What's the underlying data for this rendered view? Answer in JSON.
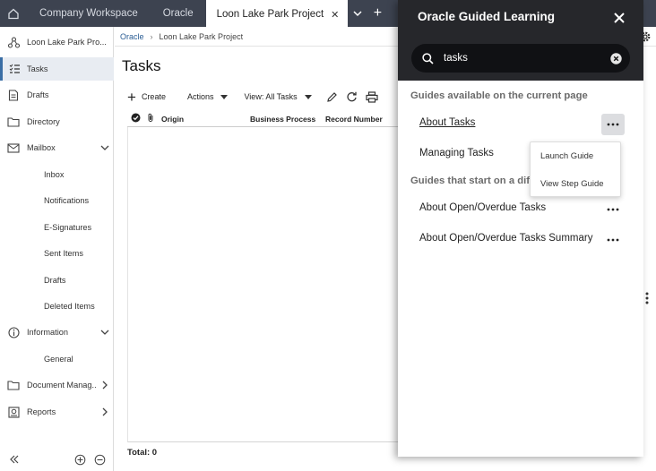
{
  "tabs": {
    "items": [
      {
        "label": "Company Workspace"
      },
      {
        "label": "Oracle"
      },
      {
        "label": "Loon Lake Park Project",
        "active": true
      }
    ]
  },
  "sidebar": {
    "project": "Loon Lake Park Pro...",
    "items": [
      {
        "label": "Tasks",
        "icon": "tasks-icon",
        "selected": true
      },
      {
        "label": "Drafts",
        "icon": "drafts-icon"
      },
      {
        "label": "Directory",
        "icon": "folder-icon"
      },
      {
        "label": "Mailbox",
        "icon": "mail-icon",
        "expanded": true
      },
      {
        "label": "Inbox"
      },
      {
        "label": "Notifications"
      },
      {
        "label": "E-Signatures"
      },
      {
        "label": "Sent Items"
      },
      {
        "label": "Drafts"
      },
      {
        "label": "Deleted Items"
      },
      {
        "label": "Information",
        "icon": "info-icon",
        "expanded": true
      },
      {
        "label": "General"
      },
      {
        "label": "Document Manag...",
        "icon": "folder-icon"
      },
      {
        "label": "Reports",
        "icon": "reports-icon"
      }
    ]
  },
  "breadcrumb": {
    "root": "Oracle",
    "current": "Loon Lake Park Project"
  },
  "main": {
    "title": "Tasks",
    "toolbar": {
      "create": "Create",
      "actions": "Actions",
      "view": "View: All Tasks"
    },
    "columns": [
      "Origin",
      "Business Process",
      "Record Number"
    ],
    "total": "Total: 0"
  },
  "ogl": {
    "title": "Oracle Guided Learning",
    "search_value": "tasks",
    "section_current": "Guides available on the current page",
    "section_other": "Guides that start on a dif",
    "guides_current": [
      "About Tasks",
      "Managing Tasks"
    ],
    "guides_other": [
      "About Open/Overdue Tasks",
      "About Open/Overdue Tasks Summary"
    ],
    "menu": {
      "launch": "Launch Guide",
      "step": "View Step Guide"
    }
  },
  "colors": {
    "topbar": "#3d4350",
    "panel_header": "#26272b",
    "accent": "#3a6ea5"
  }
}
